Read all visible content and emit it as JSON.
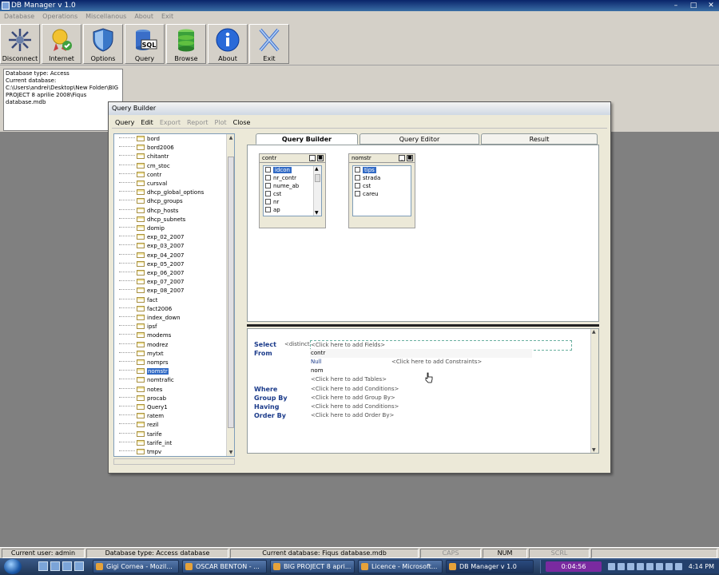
{
  "app": {
    "title": "DB Manager v 1.0"
  },
  "main_menu": [
    {
      "label": "Database"
    },
    {
      "label": "Operations"
    },
    {
      "label": "Miscellanous"
    },
    {
      "label": "About"
    },
    {
      "label": "Exit"
    }
  ],
  "toolbar": {
    "buttons": [
      {
        "label": "Disconnect",
        "icon": "disconnect-icon"
      },
      {
        "label": "Internet",
        "icon": "internet-icon"
      },
      {
        "label": "Options",
        "icon": "shield-icon"
      },
      {
        "label": "Query",
        "icon": "sql-database-icon"
      },
      {
        "label": "Browse",
        "icon": "green-database-icon"
      },
      {
        "label": "About",
        "icon": "info-icon"
      },
      {
        "label": "Exit",
        "icon": "exit-x-icon"
      }
    ]
  },
  "info_panel": {
    "line1": "Database type: Access",
    "line2": "Current database:",
    "line3": "C:\\Users\\andrei\\Desktop\\New Folder\\BIG PROJECT 8 aprilie 2008\\Fiqus database.mdb"
  },
  "query_builder": {
    "title": "Query Builder",
    "menu": [
      {
        "label": "Query",
        "enabled": true
      },
      {
        "label": "Edit",
        "enabled": true
      },
      {
        "label": "Export",
        "enabled": false
      },
      {
        "label": "Report",
        "enabled": false
      },
      {
        "label": "Plot",
        "enabled": false
      },
      {
        "label": "Close",
        "enabled": true
      }
    ],
    "tree_items": [
      "bord",
      "bord2006",
      "chitantr",
      "cm_stoc",
      "contr",
      "cursval",
      "dhcp_global_options",
      "dhcp_groups",
      "dhcp_hosts",
      "dhcp_subnets",
      "domip",
      "exp_02_2007",
      "exp_03_2007",
      "exp_04_2007",
      "exp_05_2007",
      "exp_06_2007",
      "exp_07_2007",
      "exp_08_2007",
      "fact",
      "fact2006",
      "index_down",
      "ipsf",
      "modems",
      "modrez",
      "mytxt",
      "nomprs",
      "nomstr",
      "nomtrafic",
      "notes",
      "procab",
      "Query1",
      "ratem",
      "rezil",
      "tarife",
      "tarife_int",
      "tmpv"
    ],
    "tree_selected": "nomstr",
    "tabs": [
      {
        "label": "Query Builder",
        "active": true
      },
      {
        "label": "Query Editor",
        "active": false
      },
      {
        "label": "Result",
        "active": false
      }
    ],
    "tables": [
      {
        "name": "contr",
        "fields": [
          "idcon",
          "nr_contr",
          "nume_ab",
          "cst",
          "nr",
          "ap"
        ],
        "selected": "idcon"
      },
      {
        "name": "nomstr",
        "fields": [
          "tips",
          "strada",
          "cst",
          "careu"
        ],
        "selected": "tips"
      }
    ],
    "sql": {
      "select_kw": "Select",
      "from_kw": "From",
      "where_kw": "Where",
      "groupby_kw": "Group By",
      "having_kw": "Having",
      "orderby_kw": "Order By",
      "distinct": "<distinct>",
      "fields_ph": "<Click here to add Fields>",
      "from_table1": "contr",
      "join_type": "Null",
      "from_table2": "nom",
      "constraints_ph": "<Click here to add Constraints>",
      "tables_ph": "<Click here to add Tables>",
      "where_ph": "<Click here to add Conditions>",
      "groupby_ph": "<Click here to add Group By>",
      "having_ph": "<Click here to add Conditions>",
      "orderby_ph": "<Click here to add Order By>"
    }
  },
  "statusbar": {
    "user": "Current user: admin",
    "dbtype": "Database type: Access database",
    "curdb": "Current database: Fiqus database.mdb",
    "caps": "CAPS",
    "num": "NUM",
    "scrl": "SCRL"
  },
  "taskbar": {
    "tasks": [
      {
        "label": "Gigi Cornea - Mozil..."
      },
      {
        "label": "OSCAR BENTON - ..."
      },
      {
        "label": "BIG PROJECT 8 apri..."
      },
      {
        "label": "Licence - Microsoft..."
      },
      {
        "label": "DB Manager v 1.0"
      }
    ],
    "recording_time": "0:04:56",
    "clock": "4:14 PM"
  },
  "colors": {
    "accent": "#316ac5",
    "keyword": "#1a3a8a",
    "workspace": "#808080"
  }
}
